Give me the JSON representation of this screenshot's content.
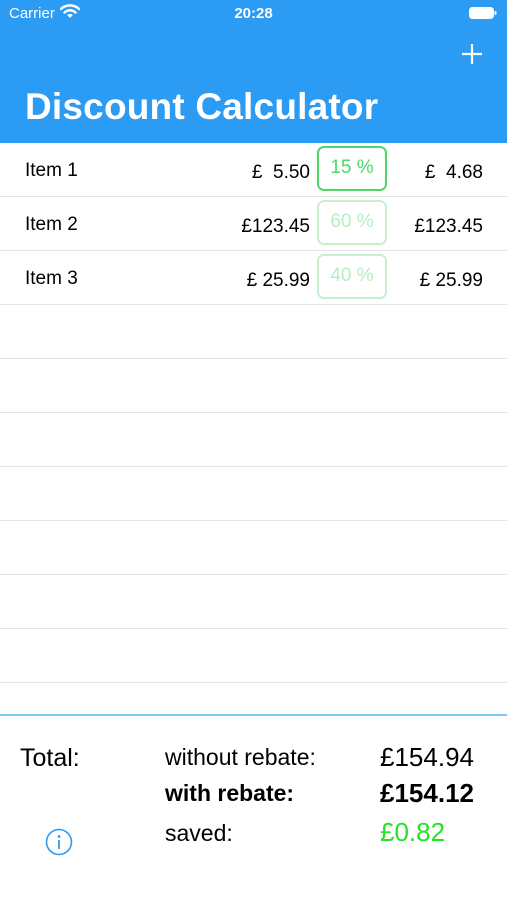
{
  "status_bar": {
    "carrier": "Carrier",
    "time": "20:28"
  },
  "header": {
    "title": "Discount Calculator",
    "add_icon": "plus-icon",
    "color": "#2c9bf4"
  },
  "items": [
    {
      "name": "Item 1",
      "price": "£  5.50",
      "discount": "15 %",
      "discount_active": true,
      "final": "£  4.68"
    },
    {
      "name": "Item 2",
      "price": "£123.45",
      "discount": "60 %",
      "discount_active": false,
      "final": "£123.45"
    },
    {
      "name": "Item 3",
      "price": "£ 25.99",
      "discount": "40 %",
      "discount_active": false,
      "final": "£ 25.99"
    }
  ],
  "totals": {
    "label": "Total:",
    "without_label": "without rebate:",
    "without_value": "£154.94",
    "with_label": "with rebate:",
    "with_value": "£154.12",
    "saved_label": "saved:",
    "saved_value": "£0.82",
    "info_icon": "info-icon",
    "saved_color": "#25e225"
  }
}
